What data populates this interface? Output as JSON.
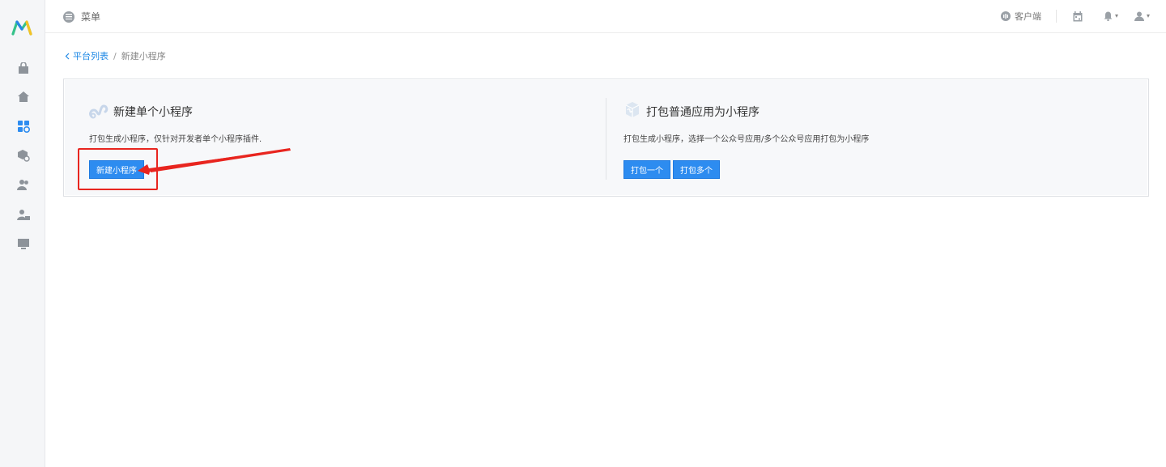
{
  "brand": {
    "logo_icon": "m-logo-icon",
    "accent": "#1e88e5",
    "primary_button": "#2d8cf0",
    "annotation": "#e8251f"
  },
  "sidebar": {
    "items": [
      {
        "icon": "shopping-bag-icon"
      },
      {
        "icon": "home-icon"
      },
      {
        "icon": "apps-settings-icon",
        "active": true
      },
      {
        "icon": "box-settings-icon"
      },
      {
        "icon": "users-icon"
      },
      {
        "icon": "user-lock-icon"
      },
      {
        "icon": "monitor-icon"
      }
    ]
  },
  "header": {
    "menu_label": "菜单",
    "client_label": "客户端",
    "icons": [
      "calendar-icon",
      "bell-icon",
      "user-icon"
    ]
  },
  "breadcrumb": {
    "back_label": "平台列表",
    "separator": "/",
    "current": "新建小程序"
  },
  "cards": {
    "single": {
      "title": "新建单个小程序",
      "description": "打包生成小程序，仅针对开发者单个小程序插件.",
      "button_label": "新建小程序"
    },
    "package": {
      "title": "打包普通应用为小程序",
      "description": "打包生成小程序，选择一个公众号应用/多个公众号应用打包为小程序",
      "button_one": "打包一个",
      "button_many": "打包多个"
    }
  }
}
